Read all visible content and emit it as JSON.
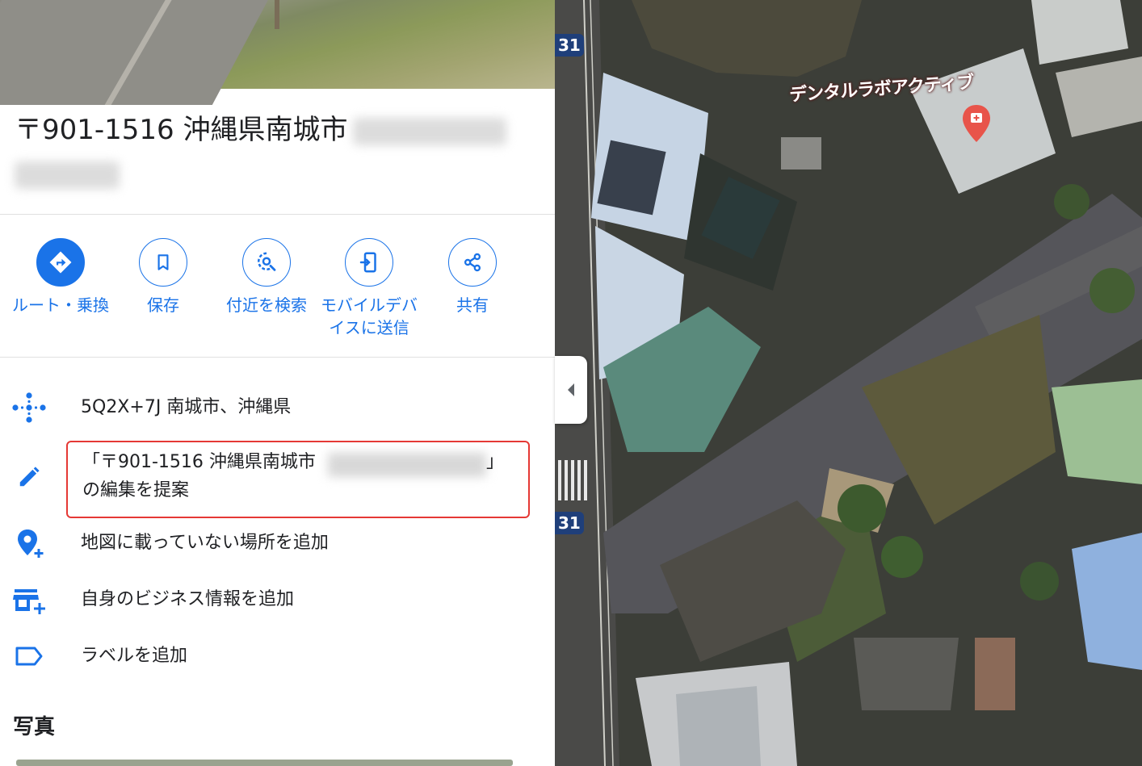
{
  "place": {
    "title": "〒901-1516 沖縄県南城市"
  },
  "actions": [
    {
      "label": "ルート・乗換",
      "icon": "directions-icon"
    },
    {
      "label": "保存",
      "icon": "bookmark-icon"
    },
    {
      "label": "付近を検索",
      "icon": "nearby-search-icon"
    },
    {
      "label": "モバイルデバイスに送信",
      "icon": "send-to-phone-icon"
    },
    {
      "label": "共有",
      "icon": "share-icon"
    }
  ],
  "details": {
    "plus_code": "5Q2X+7J 南城市、沖縄県",
    "suggest_edit": {
      "prefix": "「〒901-1516 沖縄県南城市",
      "suffix": "」",
      "line2": "の編集を提案"
    },
    "add_missing_place": "地図に載っていない場所を追加",
    "add_business": "自身のビジネス情報を追加",
    "add_label": "ラベルを追加"
  },
  "photos_heading": "写真",
  "map": {
    "poi_label": "デンタルラボアクティブ",
    "route_number": "31",
    "poi_pin_color": "#e8544a"
  },
  "colors": {
    "accent": "#1a73e8",
    "highlight_border": "#e53935"
  }
}
